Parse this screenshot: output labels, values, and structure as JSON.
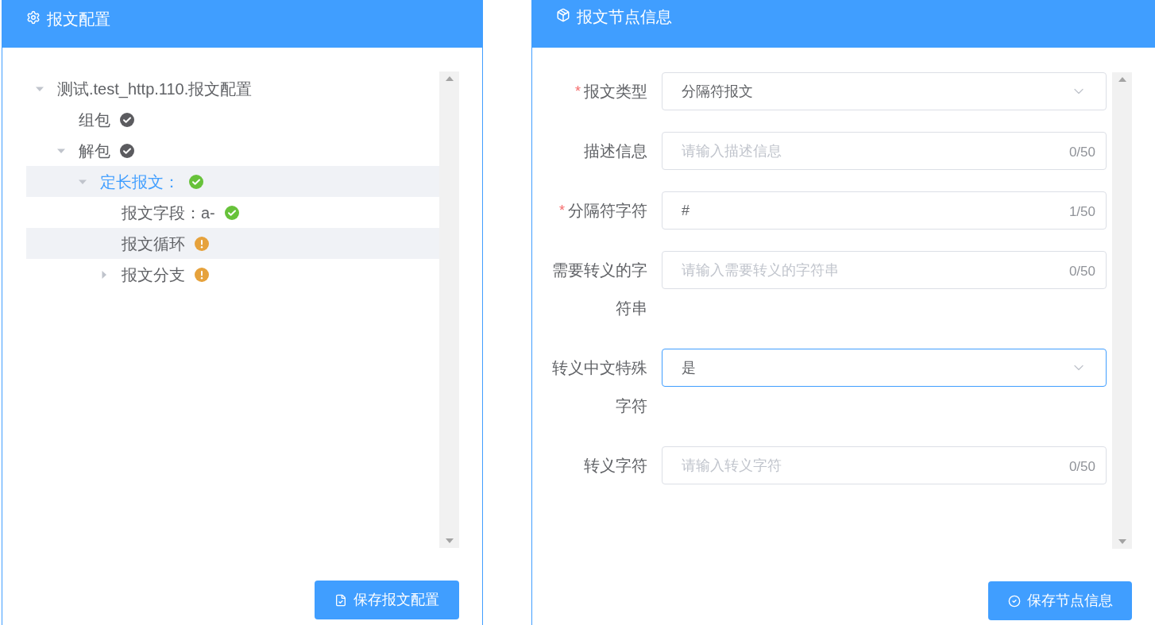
{
  "config_panel": {
    "title": "报文配置",
    "tree": [
      {
        "label": "测试.test_http.110.报文配置",
        "kind": "branch",
        "expanded": true,
        "selected": false,
        "highlighted": false,
        "children": [
          {
            "label": "组包",
            "kind": "leaf",
            "color": "#5b5b5f",
            "warning": false,
            "selected": false,
            "highlighted": false
          },
          {
            "label": "解包",
            "kind": "branch",
            "expanded": true,
            "color": "#5b5b5f",
            "warning": false,
            "selected": false,
            "highlighted": false,
            "children": [
              {
                "label": "定长报文：",
                "kind": "branch",
                "expanded": true,
                "color": "#67c23a",
                "warning": false,
                "selected": true,
                "highlighted": true,
                "children": [
                  {
                    "label": "报文字段：a-",
                    "kind": "leaf",
                    "color": "#67c23a",
                    "warning": false,
                    "selected": false,
                    "highlighted": false
                  },
                  {
                    "label": "报文循环",
                    "kind": "leaf",
                    "color": "#e6a23c",
                    "warning": true,
                    "selected": false,
                    "highlighted": true
                  },
                  {
                    "label": "报文分支",
                    "kind": "branch",
                    "expanded": false,
                    "color": "#e6a23c",
                    "warning": true,
                    "selected": false,
                    "highlighted": false
                  }
                ]
              }
            ]
          }
        ]
      }
    ],
    "button": "保存报文配置"
  },
  "node_panel": {
    "title": "报文节点信息",
    "fields": [
      {
        "kind": "select",
        "required_mark": "*",
        "label": "报文类型",
        "value": "分隔符报文",
        "focused": false
      },
      {
        "kind": "input",
        "label": "描述信息",
        "placeholder": "请输入描述信息",
        "counter": "0/50"
      },
      {
        "kind": "input",
        "required_mark": "*",
        "label": "分隔符字符",
        "value": "#",
        "counter": "1/50"
      },
      {
        "kind": "input",
        "label": "需要转义的字符串",
        "placeholder": "请输入需要转义的字符串",
        "counter": "0/50"
      },
      {
        "kind": "select",
        "label": "转义中文特殊字符",
        "value": "是",
        "focused": true
      },
      {
        "kind": "input",
        "label": "转义字符",
        "placeholder": "请输入转义字符",
        "counter": "0/50"
      }
    ],
    "button": "保存节点信息"
  }
}
